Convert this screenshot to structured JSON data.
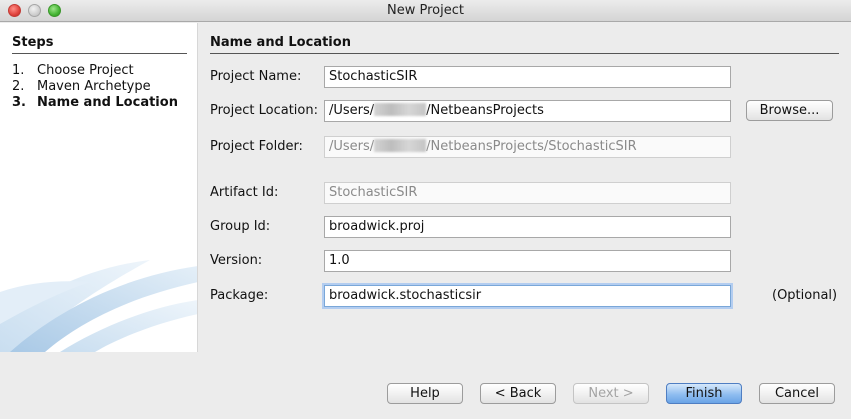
{
  "window": {
    "title": "New Project"
  },
  "steps": {
    "heading": "Steps",
    "items": [
      {
        "num": "1.",
        "label": "Choose Project"
      },
      {
        "num": "2.",
        "label": "Maven Archetype"
      },
      {
        "num": "3.",
        "label": "Name and Location"
      }
    ]
  },
  "section": {
    "title": "Name and Location"
  },
  "fields": {
    "project_name": {
      "label": "Project Name:",
      "value": "StochasticSIR"
    },
    "project_location": {
      "label": "Project Location:",
      "value_prefix": "/Users/",
      "value_suffix": "/NetbeansProjects"
    },
    "project_folder": {
      "label": "Project Folder:",
      "value_prefix": "/Users/",
      "value_suffix": "/NetbeansProjects/StochasticSIR"
    },
    "artifact_id": {
      "label": "Artifact Id:",
      "value": "StochasticSIR"
    },
    "group_id": {
      "label": "Group Id:",
      "value": "broadwick.proj"
    },
    "version": {
      "label": "Version:",
      "value": "1.0"
    },
    "package": {
      "label": "Package:",
      "value": "broadwick.stochasticsir",
      "hint": "(Optional)"
    }
  },
  "buttons": {
    "browse": "Browse...",
    "help": "Help",
    "back": "< Back",
    "next": "Next >",
    "finish": "Finish",
    "cancel": "Cancel"
  }
}
